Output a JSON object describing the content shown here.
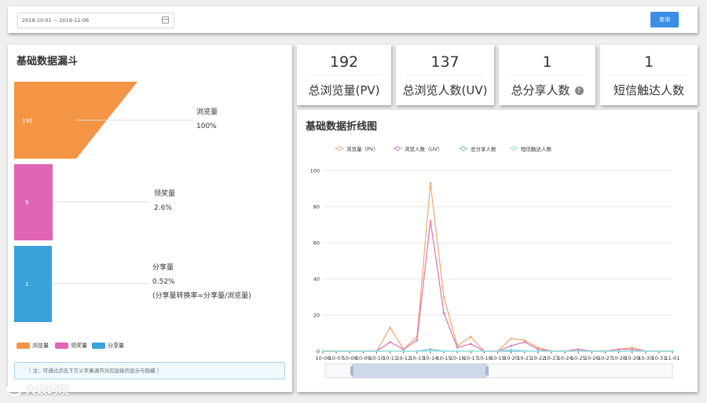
{
  "filter_bar": {
    "date_range": "2019-10-01 ~ 2019-12-06",
    "query_label": "查询"
  },
  "funnel": {
    "title": "基础数据漏斗",
    "stages": [
      {
        "value": "192",
        "name": "浏览量",
        "rate": "100%",
        "color": "#f39544"
      },
      {
        "value": "5",
        "name": "领奖量",
        "rate": "2.6%",
        "color": "#e065b4"
      },
      {
        "value": "1",
        "name": "分享量",
        "rate": "0.52%",
        "color": "#3aa2db"
      }
    ],
    "conversion_note": "(分享量转换率=分享量/浏览量)",
    "legend": [
      "浏览量",
      "领奖量",
      "分享量"
    ],
    "note": "（ 注：可通过点击下方义字果调节对应层级的显示与隐藏 ）"
  },
  "stats": [
    {
      "value": "192",
      "label": "总浏览量(PV)"
    },
    {
      "value": "137",
      "label": "总浏览人数(UV)"
    },
    {
      "value": "1",
      "label": "总分享人数",
      "help_icon": "question-circle-icon"
    },
    {
      "value": "1",
      "label": "短信触达人数"
    }
  ],
  "line_chart": {
    "title": "基础数据折线图",
    "x_tick_labels": [
      "10-06",
      "10-07",
      "10-08",
      "10-09",
      "10-10",
      "10-11",
      "10-12",
      "10-13",
      "10-14",
      "10-15",
      "10-16",
      "10-17",
      "10-18",
      "10-19",
      "10-20",
      "10-21",
      "10-22",
      "10-23",
      "10-24",
      "10-25",
      "10-26",
      "10-27",
      "10-28",
      "10-29",
      "10-30",
      "10-31",
      "11-01"
    ]
  },
  "chart_data": {
    "type": "line",
    "x": [
      "10-06",
      "10-07",
      "10-08",
      "10-09",
      "10-10",
      "10-11",
      "10-12",
      "10-13",
      "10-14",
      "10-15",
      "10-16",
      "10-17",
      "10-18",
      "10-19",
      "10-20",
      "10-21",
      "10-22",
      "10-23",
      "10-24",
      "10-25",
      "10-26",
      "10-27",
      "10-28",
      "10-29",
      "10-30",
      "10-31",
      "11-01"
    ],
    "series": [
      {
        "name": "浏览量（PV）",
        "color": "#f3a56b",
        "values": [
          0,
          0,
          0,
          0,
          0,
          13,
          1,
          8,
          93,
          30,
          3,
          8,
          0,
          0,
          7,
          6,
          2,
          0,
          0,
          1,
          0,
          0,
          1,
          2,
          0,
          0,
          0
        ]
      },
      {
        "name": "浏览人数（UV）",
        "color": "#e070b4",
        "values": [
          0,
          0,
          0,
          0,
          0,
          5,
          1,
          6,
          72,
          21,
          2,
          4,
          0,
          0,
          3,
          5,
          1,
          0,
          0,
          1,
          0,
          0,
          1,
          1,
          0,
          0,
          0
        ]
      },
      {
        "name": "总分享人数",
        "color": "#6fb3e0",
        "values": [
          0,
          0,
          0,
          0,
          0,
          0,
          0,
          0,
          1,
          0,
          0,
          0,
          0,
          0,
          0,
          0,
          0,
          0,
          0,
          0,
          0,
          0,
          0,
          0,
          0,
          0,
          0
        ]
      },
      {
        "name": "短信触达人数",
        "color": "#8fe0d8",
        "values": [
          0,
          0,
          0,
          0,
          0,
          0,
          0,
          0,
          0,
          0,
          0,
          0,
          0,
          0,
          1,
          0,
          0,
          0,
          0,
          0,
          0,
          0,
          0,
          0,
          0,
          0,
          0
        ]
      }
    ],
    "y_ticks": [
      0,
      20,
      40,
      60,
      80,
      100
    ],
    "ylim": [
      0,
      100
    ],
    "grid": true,
    "legend_position": "top"
  },
  "watermark": "大数跨境"
}
